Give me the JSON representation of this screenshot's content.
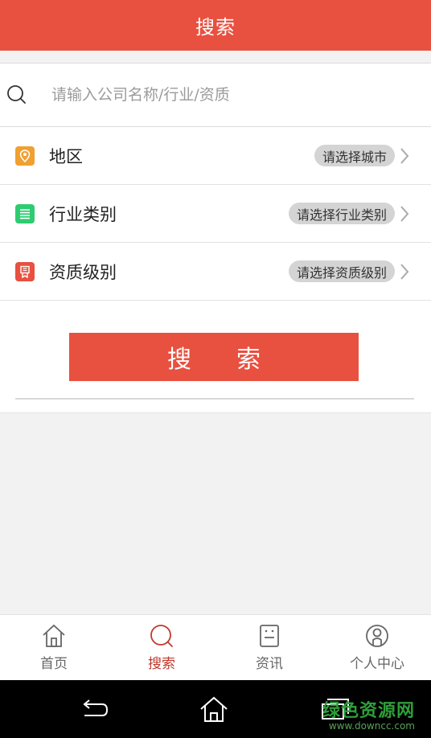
{
  "header": {
    "title": "搜索"
  },
  "search": {
    "placeholder": "请输入公司名称/行业/资质"
  },
  "filters": [
    {
      "label": "地区",
      "value": "请选择城市",
      "icon": "location-pin-icon",
      "color": "#f0a030"
    },
    {
      "label": "行业类别",
      "value": "请选择行业类别",
      "icon": "list-icon",
      "color": "#2ecc71"
    },
    {
      "label": "资质级别",
      "value": "请选择资质级别",
      "icon": "award-icon",
      "color": "#e85040"
    }
  ],
  "search_button": {
    "label": "搜索"
  },
  "tabbar": {
    "items": [
      {
        "label": "首页",
        "icon": "home-icon",
        "active": false
      },
      {
        "label": "搜索",
        "icon": "search-icon",
        "active": true
      },
      {
        "label": "资讯",
        "icon": "news-icon",
        "active": false
      },
      {
        "label": "个人中心",
        "icon": "user-icon",
        "active": false
      }
    ]
  },
  "watermark": {
    "line1": "绿色资源网",
    "line2": "www.downcc.com"
  },
  "colors": {
    "accent": "#e85040",
    "active_tab": "#c0392b"
  }
}
